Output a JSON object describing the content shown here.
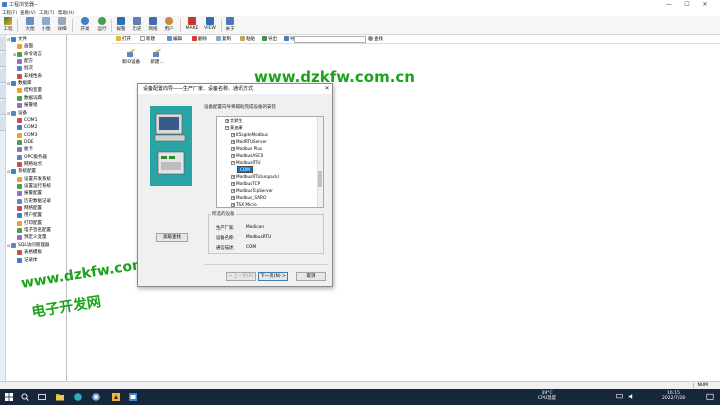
{
  "window": {
    "title": "工程浏览器--",
    "controls": [
      "—",
      "☐",
      "✕"
    ]
  },
  "menu": [
    "工程(F)",
    "查看(V)",
    "工具(T)",
    "帮助(H)"
  ],
  "toolbar": {
    "buttons": [
      "工程",
      "大图",
      "小图",
      "详细",
      "开发",
      "运行",
      "报警",
      "历史",
      "网络",
      "用户",
      "MAKE",
      "VIEW",
      "关于"
    ]
  },
  "tree": {
    "items": [
      {
        "label": "文件",
        "level": 0,
        "exp": "⊟"
      },
      {
        "label": "画面",
        "level": 1
      },
      {
        "label": "命令语言",
        "level": 1,
        "exp": "⊞"
      },
      {
        "label": "配方",
        "level": 1
      },
      {
        "label": "批次",
        "level": 1
      },
      {
        "label": "非线性表",
        "level": 1
      },
      {
        "label": "数据库",
        "level": 0,
        "exp": "⊟"
      },
      {
        "label": "结构变量",
        "level": 1
      },
      {
        "label": "数据词典",
        "level": 1
      },
      {
        "label": "报警组",
        "level": 1
      },
      {
        "label": "设备",
        "level": 0,
        "exp": "⊟"
      },
      {
        "label": "COM1",
        "level": 1
      },
      {
        "label": "COM2",
        "level": 1
      },
      {
        "label": "COM3",
        "level": 1
      },
      {
        "label": "DDE",
        "level": 1
      },
      {
        "label": "板卡",
        "level": 1
      },
      {
        "label": "OPC服务器",
        "level": 1
      },
      {
        "label": "网络站点",
        "level": 1
      },
      {
        "label": "系统配置",
        "level": 0,
        "exp": "⊟"
      },
      {
        "label": "设置开发系统",
        "level": 1
      },
      {
        "label": "设置运行系统",
        "level": 1
      },
      {
        "label": "报警配置",
        "level": 1
      },
      {
        "label": "历史数据记录",
        "level": 1
      },
      {
        "label": "网络配置",
        "level": 1
      },
      {
        "label": "用户配置",
        "level": 1
      },
      {
        "label": "打印配置",
        "level": 1
      },
      {
        "label": "电子签名配置",
        "level": 1
      },
      {
        "label": "预定义变量",
        "level": 1
      },
      {
        "label": "SQL访问管理器",
        "level": 0,
        "exp": "⊟"
      },
      {
        "label": "表格模板",
        "level": 1
      },
      {
        "label": "记录体",
        "level": 1
      }
    ]
  },
  "content_toolbar": {
    "items": [
      "打开",
      "新建",
      "编辑",
      "删除",
      "复制",
      "粘贴",
      "导出",
      "导入",
      "查找"
    ],
    "search_value": ""
  },
  "content": {
    "devices": [
      "新IO设备",
      "新建..."
    ]
  },
  "watermarks": [
    "www.dzkfw.com.cn",
    "www.dzkfw.com.cn",
    "电子开发网"
  ],
  "dialog": {
    "title": "设备配置向导——生产厂家、设备名称、通讯方式",
    "subtitle": "设备配置向导将辅助完成设备的安装",
    "advanced_button": "高级查找",
    "tree_rows": [
      {
        "label": "艾默生",
        "indent": 1,
        "sign": "+"
      },
      {
        "label": "莫迪康",
        "indent": 1,
        "sign": "−"
      },
      {
        "label": "K5sgdnModbus",
        "indent": 2,
        "sign": "+"
      },
      {
        "label": "ModRTUServer",
        "indent": 2,
        "sign": "+"
      },
      {
        "label": "Modbus Plus",
        "indent": 2,
        "sign": "+"
      },
      {
        "label": "ModbusASCII",
        "indent": 2,
        "sign": "+"
      },
      {
        "label": "ModbusRTU",
        "indent": 2,
        "sign": "−"
      },
      {
        "label": "COM",
        "indent": 3,
        "sign": "",
        "selected": true
      },
      {
        "label": "ModbusRTU(unpack)",
        "indent": 2,
        "sign": "+"
      },
      {
        "label": "ModbusTCP",
        "indent": 2,
        "sign": "+"
      },
      {
        "label": "ModbusTcpServer",
        "indent": 2,
        "sign": "+"
      },
      {
        "label": "Modbus_SARO",
        "indent": 2,
        "sign": "+"
      },
      {
        "label": "TSX Micro",
        "indent": 2,
        "sign": "+"
      }
    ],
    "selected_group": {
      "title": "所选的设备",
      "fields": [
        {
          "key": "生产厂家:",
          "value": "Modicon"
        },
        {
          "key": "设备名称:",
          "value": "ModbusRTU"
        },
        {
          "key": "通信描述:",
          "value": "COM"
        }
      ]
    },
    "buttons": {
      "prev": "< 上一步(B)",
      "next": "下一页(N) >",
      "cancel": "取消"
    }
  },
  "statusbar": {
    "num": "NUM"
  },
  "taskbar": {
    "temp": "39°C",
    "cpu": "CPU温度",
    "time": "16:15",
    "date": "2022/7/28"
  },
  "colors": {
    "watermark": "#1aa31a",
    "taskbar": "#16273a",
    "selection": "#0078d7",
    "illustration": "#2aa5a5"
  }
}
